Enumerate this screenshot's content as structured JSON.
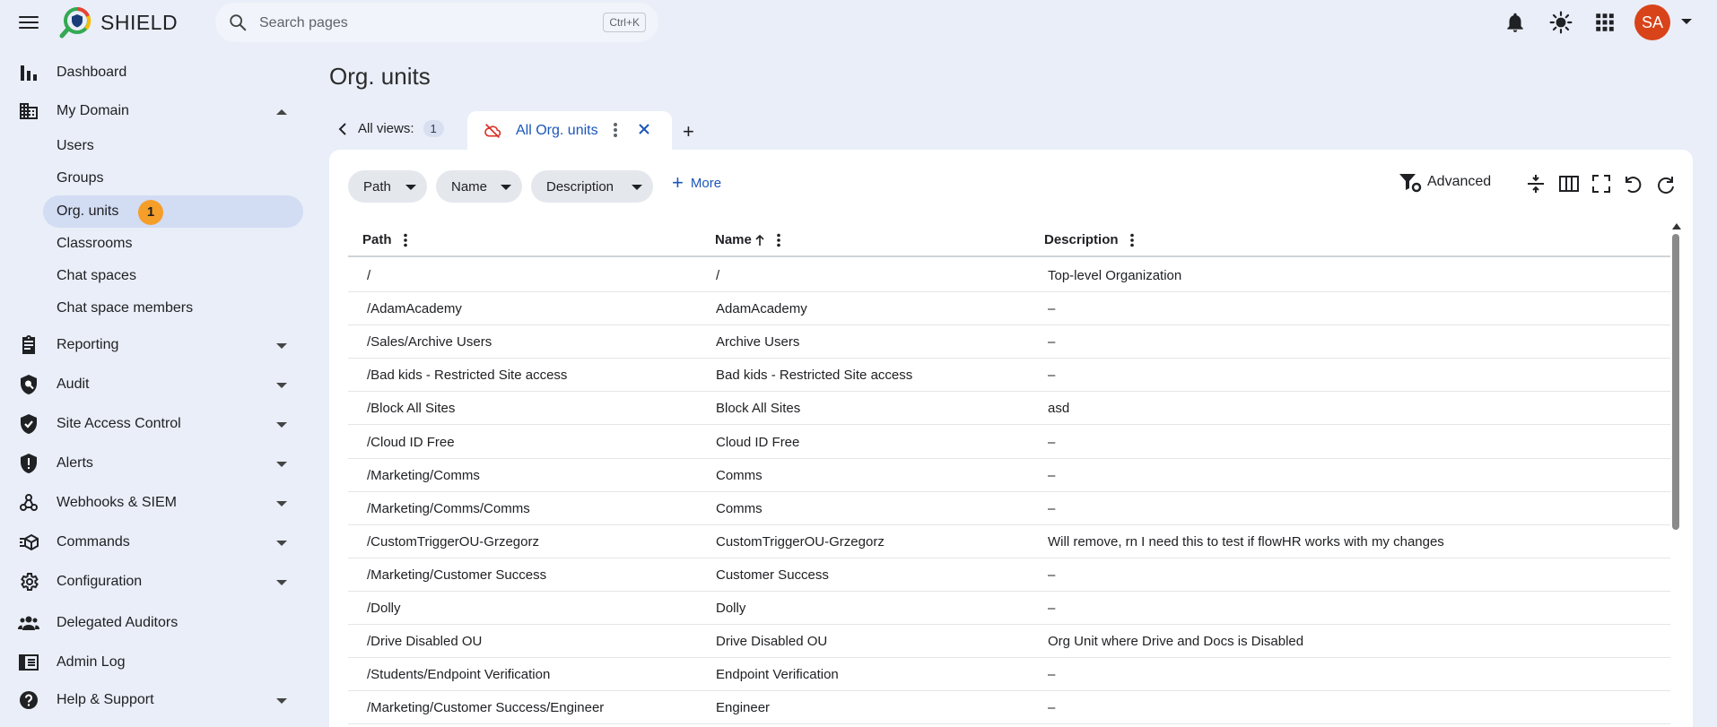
{
  "app": {
    "brand": "SHIELD",
    "search_placeholder": "Search pages",
    "search_shortcut": "Ctrl+K",
    "user_initials": "SA",
    "avatar_color": "#d8431a"
  },
  "sidebar": {
    "items": [
      {
        "label": "Dashboard",
        "icon": "bar-chart-icon"
      },
      {
        "label": "My Domain",
        "icon": "domain-icon",
        "expanded": true
      },
      {
        "label": "Reporting",
        "icon": "clipboard-icon"
      },
      {
        "label": "Audit",
        "icon": "audit-shield-icon"
      },
      {
        "label": "Site Access Control",
        "icon": "shield-check-icon"
      },
      {
        "label": "Alerts",
        "icon": "alert-shield-icon"
      },
      {
        "label": "Webhooks & SIEM",
        "icon": "webhook-icon"
      },
      {
        "label": "Commands",
        "icon": "commands-icon"
      },
      {
        "label": "Configuration",
        "icon": "gear-icon"
      },
      {
        "label": "Delegated Auditors",
        "icon": "people-icon"
      },
      {
        "label": "Admin Log",
        "icon": "log-icon"
      },
      {
        "label": "Help & Support",
        "icon": "help-icon"
      }
    ],
    "sub_items": [
      {
        "label": "Users"
      },
      {
        "label": "Groups"
      },
      {
        "label": "Org. units",
        "active": true,
        "badge": "1"
      },
      {
        "label": "Classrooms"
      },
      {
        "label": "Chat spaces"
      },
      {
        "label": "Chat space members"
      }
    ]
  },
  "main": {
    "title": "Org. units",
    "views_label": "All views:",
    "views_count": "1",
    "active_tab": "All Org. units",
    "filters": [
      "Path",
      "Name",
      "Description"
    ],
    "more_label": "More",
    "advanced_label": "Advanced",
    "accent": "#1a56b8"
  },
  "table": {
    "columns": [
      "Path",
      "Name",
      "Description"
    ],
    "sort": {
      "column": "Name",
      "direction": "asc"
    },
    "rows": [
      [
        "/",
        "/",
        "Top-level Organization"
      ],
      [
        "/AdamAcademy",
        "AdamAcademy",
        "–"
      ],
      [
        "/Sales/Archive Users",
        "Archive Users",
        "–"
      ],
      [
        "/Bad kids - Restricted Site access",
        "Bad kids - Restricted Site access",
        "–"
      ],
      [
        "/Block All Sites",
        "Block All Sites",
        "asd"
      ],
      [
        "/Cloud ID Free",
        "Cloud ID Free",
        "–"
      ],
      [
        "/Marketing/Comms",
        "Comms",
        "–"
      ],
      [
        "/Marketing/Comms/Comms",
        "Comms",
        "–"
      ],
      [
        "/CustomTriggerOU-Grzegorz",
        "CustomTriggerOU-Grzegorz",
        "Will remove, rn I need this to test if flowHR works with my changes"
      ],
      [
        "/Marketing/Customer Success",
        "Customer Success",
        "–"
      ],
      [
        "/Dolly",
        "Dolly",
        "–"
      ],
      [
        "/Drive Disabled OU",
        "Drive Disabled OU",
        "Org Unit where Drive and Docs is Disabled"
      ],
      [
        "/Students/Endpoint Verification",
        "Endpoint Verification",
        "–"
      ],
      [
        "/Marketing/Customer Success/Engineer",
        "Engineer",
        "–"
      ]
    ]
  }
}
